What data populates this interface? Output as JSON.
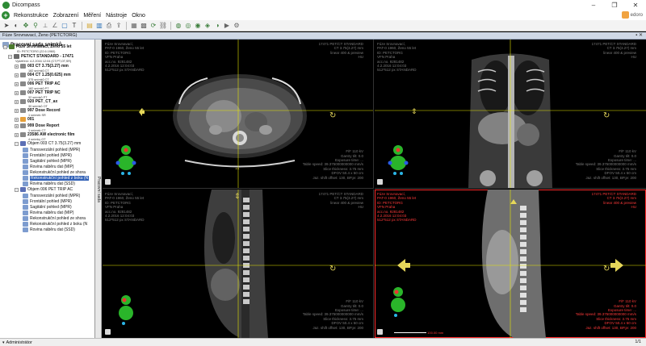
{
  "window": {
    "title": "Dicompass"
  },
  "menu": {
    "items": [
      "Rekonstrukce",
      "Zobrazení",
      "Měření",
      "Nástroje",
      "Okno"
    ],
    "user_label": "edoro"
  },
  "toolbar": {
    "icons": [
      "cursor-icon",
      "contrast-icon",
      "pan-icon",
      "zoom-icon",
      "ruler-icon",
      "angle-icon",
      "roi-icon",
      "text-icon",
      "folder-icon",
      "save-icon",
      "print-icon",
      "export-icon",
      "layout-icon",
      "grid-icon",
      "sync-icon",
      "link-icon",
      "volume-icon",
      "mpr-icon",
      "mip-icon",
      "3d-icon",
      "fusion-icon",
      "cine-icon",
      "settings-icon"
    ]
  },
  "panel": {
    "title": "Fúze Srovnavací, Ženo (PETCTORG)"
  },
  "sidebar": {
    "title": "Pracovní sada snímků",
    "patient": {
      "name": "Fúze Srovnavací, Ženo 55 let",
      "id": "ID: PETCTORG (22.6.1960)"
    },
    "study": {
      "name": "PET/CT STANDARD - 17471",
      "sub": "Vyšetření: 4.2.2016 12:04 (CT,PT,OT,SR)"
    },
    "series": [
      {
        "label": "003 CT 3.75(3.27) mm",
        "sub": "182 snímků CT"
      },
      {
        "label": "004 CT 1.25(0.625) mm",
        "sub": "375 snímků CT"
      },
      {
        "label": "006 PET TRIP AC",
        "sub": "182 snímků PT"
      },
      {
        "label": "007 PET TRIP NC",
        "sub": "32 snímků PT"
      },
      {
        "label": "020 PET_CT_ax",
        "sub": "30 snímků OT"
      },
      {
        "label": "997 Dose Record",
        "sub": "1 snímek SR"
      },
      {
        "label": "001",
        "sub": ""
      },
      {
        "label": "999 Dose Report",
        "sub": "1 snímek CT"
      },
      {
        "label": "23586 AW electronic film",
        "sub": "4 snímky OT"
      }
    ],
    "volume1": {
      "label": "Objem 003 CT 3.75(3.27) mm",
      "items": [
        "Transverzální pohled (MPR)",
        "Frontální pohled (MPR)",
        "Sagitální pohled (MPR)",
        "Rovina náběru dat (MIP)",
        "Rekonstrukční pohled ze shora",
        "Rekonstrukční pohled z boku (N",
        "Rovina náběru dat (SSD)"
      ],
      "selected_index": 5
    },
    "volume2": {
      "label": "Objem 006 PET TRIP AC",
      "items": [
        "Transverzální pohled (MPR)",
        "Frontální pohled (MPR)",
        "Sagitální pohled (MPR)",
        "Rovina náběru dat (MIP)",
        "Rekonstrukční pohled ze shora",
        "Rekonstrukční pohled z boku (N",
        "Rovina náběru dat (SSD)"
      ]
    },
    "side_tab": "Pracovní sada"
  },
  "viewports": [
    {
      "tl": "Fúze Srovnavací,\nPAT-0 1960, Ženo 55 let\nID: PETCTORG\nVFN Praha\nacc.no. 9281482\n4.2.2016 12:04:03\n512*512 px STANDARD",
      "tr": "17471 PET/CT STANDARD\nCT 3.75(3.27) mm\nlinear 400 & preview\nHU",
      "br": "F/F 110 kV\nGantry tilt: 0.0\nExposure time: ...\nTable speed: 39.375000000000 mm/s\nSlice thickness: 3.75 mm\nDFOV 50.4 x 50 cm\nJaz. shift offset: 130, BP.je: 200"
    },
    {
      "tl": "Fúze Srovnavací,\nPAT-0 1960, Ženo 55 let\nID: PETCTORG\nVFN Praha\nacc.no. 9281482\n4.2.2016 12:04:03\n512*512 px STANDARD",
      "tr": "17471 PET/CT STANDARD\nCT 3.75(3.27) mm\nlinear 400 & preview\nHU",
      "br": "F/F 110 kV\nGantry tilt: 0.0\nExposure time: ...\nTable speed: 39.375000000000 mm/s\nSlice thickness: 3.75 mm\nDFOV 50.4 x 50 cm\nJaz. shift offset: 130, BP.je: 200"
    },
    {
      "tl": "Fúze Srovnavací,\nPAT-0 1960, Ženo 55 let\nID: PETCTORG\nVFN Praha\nacc.no. 9281482\n4.2.2016 12:04:03\n512*512 px STANDARD",
      "tr": "17471 PET/CT STANDARD\nCT 3.75(3.27) mm\nlinear 400 & preview\nHU",
      "br": "F/F 110 kV\nGantry tilt: 0.0\nExposure time: ...\nTable speed: 39.375000000000 mm/s\nSlice thickness: 3.75 mm\nDFOV 50.4 x 50 cm\nJaz. shift offset: 130, BP.je: 200"
    },
    {
      "tl": "Fúze Srovnavací,\nPAT-0 1960, Ženo 55 let\nID: PETCTORG\nVFN Praha\nacc.no. 9281482\n4.2.2016 12:04:03\n512*512 px STANDARD",
      "tr": "17471 PET/CT STANDARD\nCT 3.75(3.27) mm\nlinear 400 & preview\nHU",
      "br": "F/F 110 kV\nGantry tilt: 0.0\nExposure time: ...\nTable speed: 39.375000000000 mm/s\nSlice thickness: 3.75 mm\nDFOV 50.4 x 50 cm\nJaz. shift offset: 130, BP.je: 200",
      "scale_label": "100.00 mm"
    }
  ],
  "status": {
    "user": "Administrátor",
    "page": "1/1"
  },
  "colors": {
    "accent_red": "#ff2a2a",
    "crosshair": "#e6e600",
    "nav_arrow": "#e6d75a",
    "brand_green": "#2d8a34"
  }
}
